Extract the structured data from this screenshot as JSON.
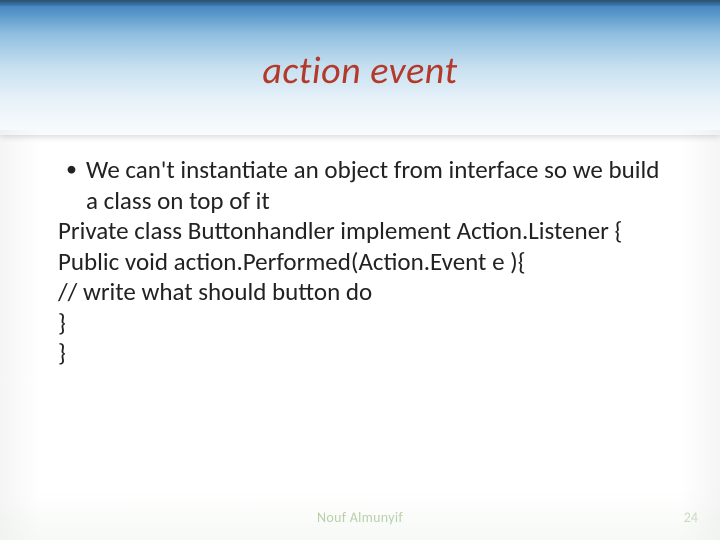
{
  "slide": {
    "title": "action event",
    "bullet": "We can't instantiate an object from interface so we build a class on top of it",
    "lines": [
      "Private class Buttonhandler implement Action.Listener {",
      "Public void action.Performed(Action.Event e ){",
      "// write what should button do",
      "}",
      "}"
    ],
    "footer_author": "Nouf Almunyif",
    "slide_number": "24"
  }
}
